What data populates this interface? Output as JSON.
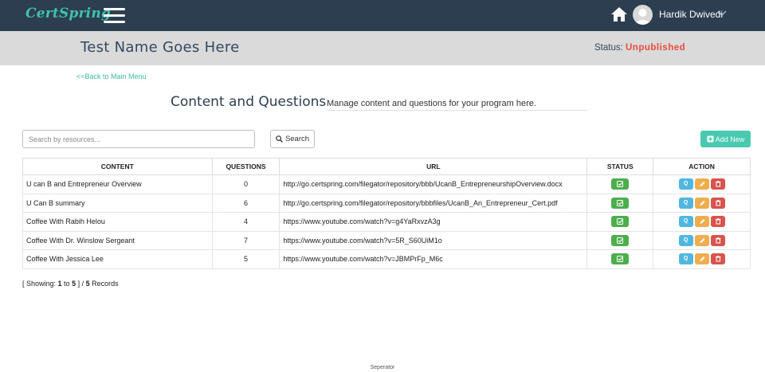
{
  "app": {
    "logo": "CertSpring"
  },
  "nav": {
    "user_name": "Hardik Dwivedi",
    "home_icon": "home-icon",
    "menu_icon": "hamburger-icon"
  },
  "header": {
    "title": "Test Name Goes Here",
    "status_label": "Status: ",
    "status_value": "Unpublished"
  },
  "back_link": "<<Back to Main Menu",
  "section": {
    "title": "Content and Questions",
    "subtitle": "Manage content and questions for your program here."
  },
  "search": {
    "placeholder": "Search by resources...",
    "button_label": "Search"
  },
  "add_button": "Add New",
  "table": {
    "headers": [
      "CONTENT",
      "QUESTIONS",
      "URL",
      "STATUS",
      "ACTION"
    ],
    "rows": [
      {
        "content": "U can B and Entrepreneur Overview",
        "questions": "0",
        "url": "http://go.certspring.com/filegator/repository/bbb/UcanB_EntrepreneurshipOverview.docx"
      },
      {
        "content": "U Can B summary",
        "questions": "6",
        "url": "http://go.certspring.com/filegator/repository/bbbfiles/UcanB_An_Entrepreneur_Cert.pdf"
      },
      {
        "content": "Coffee With Rabih Helou",
        "questions": "4",
        "url": "https://www.youtube.com/watch?v=g4YaRxvzA3g"
      },
      {
        "content": "Coffee With Dr. Winslow Sergeant",
        "questions": "7",
        "url": "https://www.youtube.com/watch?v=5R_S60UiM1o"
      },
      {
        "content": "Coffee With Jessica Lee",
        "questions": "5",
        "url": "https://www.youtube.com/watch?v=JBMPrFp_M6c"
      }
    ],
    "action_q_label": "Q"
  },
  "records": {
    "prefix": "[ Showing: ",
    "from": "1",
    "to_word": " to ",
    "to": "5",
    "mid": " ] / ",
    "total": "5",
    "suffix": " Records"
  },
  "footer": "Seperator",
  "colors": {
    "nav_bg": "#2c3e50",
    "accent": "#48c9b0",
    "status_unpublished": "#e74c3c"
  }
}
